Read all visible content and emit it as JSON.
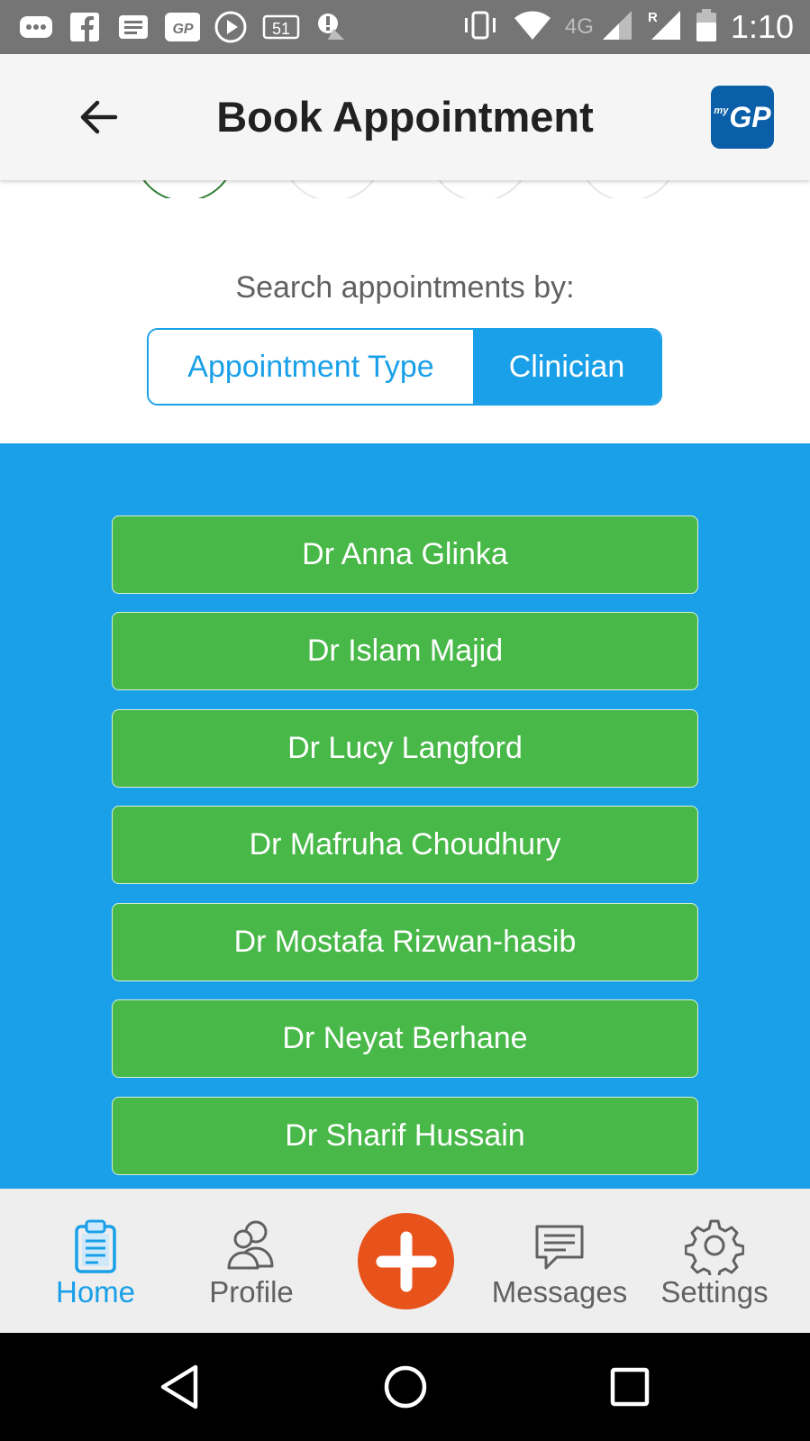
{
  "status_bar": {
    "time": "1:10",
    "network": "4G",
    "roaming": "R",
    "notification_icons": [
      "more-icon",
      "facebook-icon",
      "news-icon",
      "mygp-icon",
      "play-icon",
      "calendar-icon",
      "alert-icon"
    ],
    "calendar_text": "51"
  },
  "header": {
    "title": "Book Appointment",
    "brand_my": "my",
    "brand": "GP"
  },
  "search": {
    "label": "Search appointments by:",
    "options": [
      "Appointment Type",
      "Clinician"
    ],
    "selected": "Clinician"
  },
  "clinicians": [
    "Dr Anna Glinka",
    "Dr Islam Majid",
    "Dr Lucy Langford",
    "Dr Mafruha Choudhury",
    "Dr Mostafa Rizwan-hasib",
    "Dr Neyat Berhane",
    "Dr Sharif Hussain"
  ],
  "bottom_nav": {
    "home": "Home",
    "profile": "Profile",
    "messages": "Messages",
    "settings": "Settings",
    "active": "Home"
  },
  "colors": {
    "primary": "#1aa0e8",
    "clinician_button": "#48b848",
    "fab": "#e8521b",
    "brand": "#0a5fa8"
  }
}
